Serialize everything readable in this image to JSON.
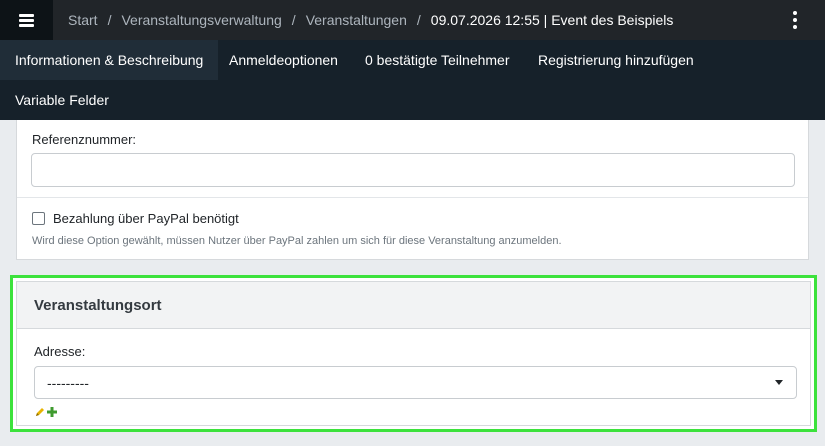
{
  "header": {
    "breadcrumbs": [
      "Start",
      "Veranstaltungsverwaltung",
      "Veranstaltungen"
    ],
    "current_page": "09.07.2026 12:55 | Event des Beispiels"
  },
  "tabs": [
    {
      "label": "Informationen & Beschreibung",
      "active": true
    },
    {
      "label": "Anmeldeoptionen",
      "active": false
    },
    {
      "label": "0 bestätigte Teilnehmer",
      "active": false
    },
    {
      "label": "Registrierung hinzufügen",
      "active": false
    },
    {
      "label": "Variable Felder",
      "active": false
    }
  ],
  "form": {
    "reference_label": "Referenznummer:",
    "reference_value": "",
    "paypal_label": "Bezahlung über PayPal benötigt",
    "paypal_checked": false,
    "paypal_help": "Wird diese Option gewählt, müssen Nutzer über PayPal zahlen um sich für diese Veranstaltung anzumelden."
  },
  "location": {
    "title": "Veranstaltungsort",
    "address_label": "Adresse:",
    "address_selected": "---------",
    "icons": [
      "pencil-icon",
      "plus-icon"
    ]
  },
  "colors": {
    "topbar": "#212529",
    "subnav": "#16212a",
    "highlight": "#3ce23c",
    "plus": "#3f9b2f"
  }
}
